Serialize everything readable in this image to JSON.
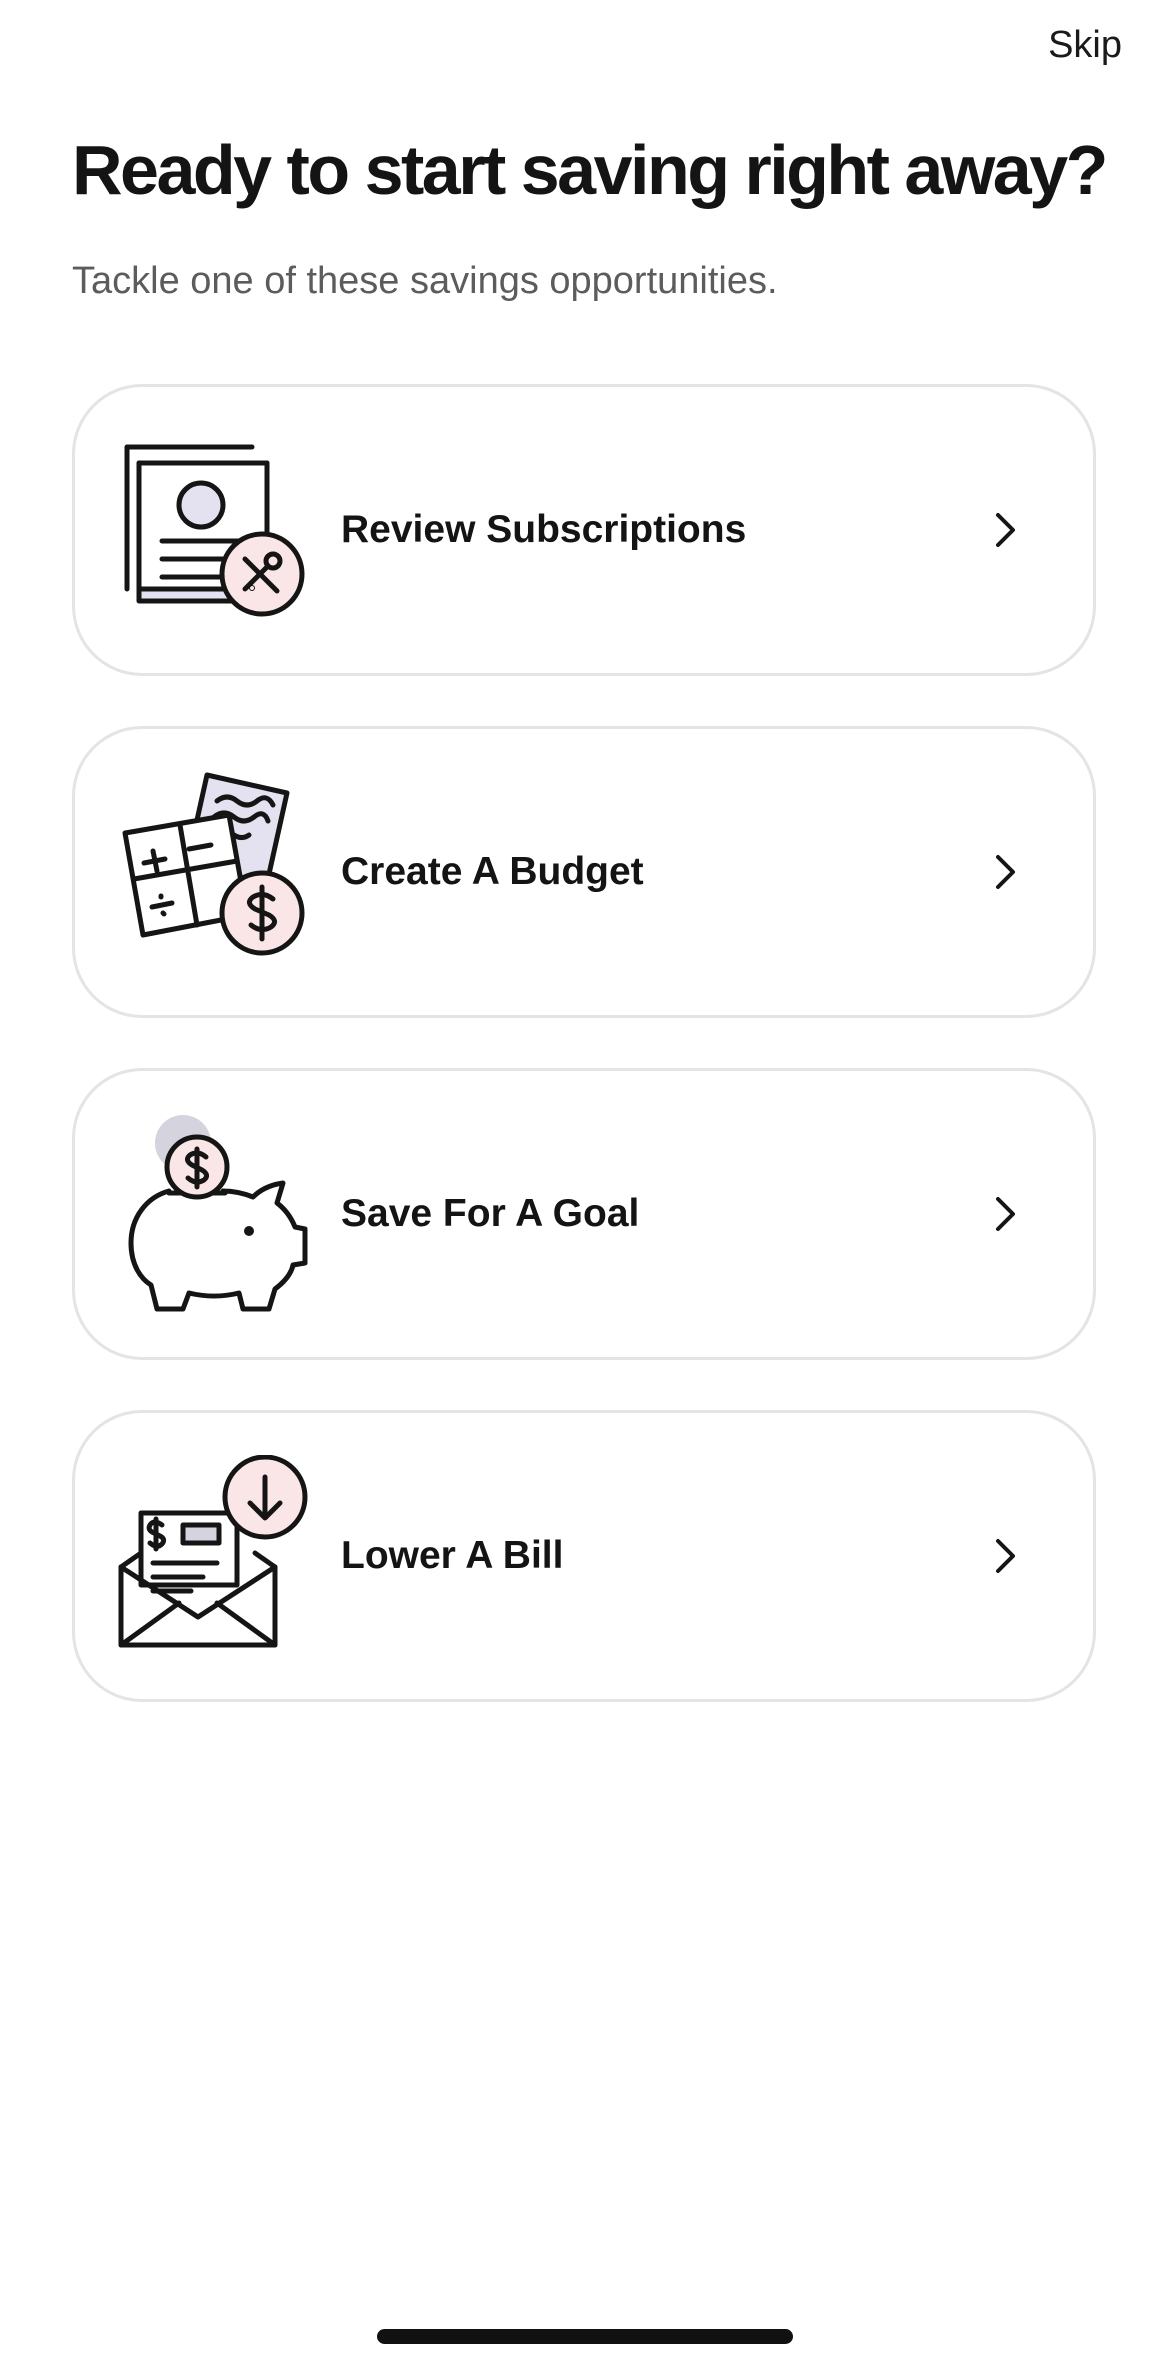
{
  "header": {
    "skip_label": "Skip",
    "title": "Ready to start saving right away?",
    "subtitle": "Tackle one of these savings opportunities."
  },
  "options": [
    {
      "label": "Review Subscriptions",
      "icon": "subscription-cancel-icon"
    },
    {
      "label": "Create A Budget",
      "icon": "budget-calculator-icon"
    },
    {
      "label": "Save For A Goal",
      "icon": "piggy-bank-icon"
    },
    {
      "label": "Lower A Bill",
      "icon": "bill-envelope-icon"
    }
  ],
  "colors": {
    "text": "#141414",
    "subtitle": "#5c5c5c",
    "card_border": "#e4e4e4",
    "accent_pink": "#fbe6e7",
    "accent_lavender": "#e4e2f1",
    "accent_gray": "#d4d3de"
  }
}
